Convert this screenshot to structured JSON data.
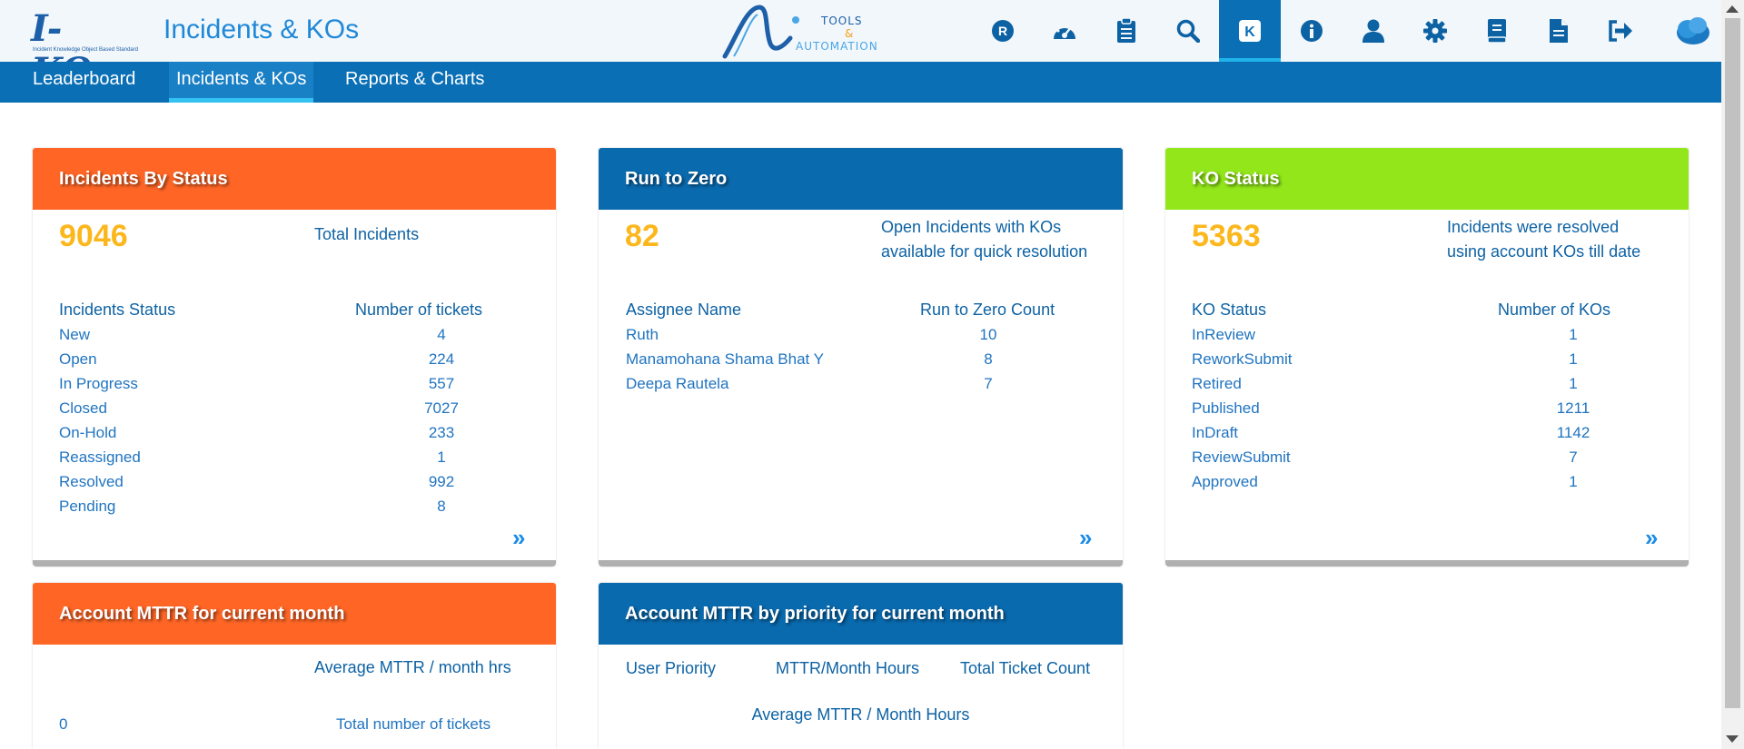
{
  "header": {
    "logo_text": "I-KO",
    "logo_eta": "η",
    "logo_subtitle": "Incident Knowledge Object Based Standard",
    "app_title": "Incidents & KOs",
    "partner_logo": {
      "line1": "TOOLS",
      "amp": "&",
      "line2": "AUTOMATION"
    },
    "icons": [
      "r-badge-icon",
      "dashboard-gauge-icon",
      "clipboard-icon",
      "search-icon",
      "ko-icon",
      "info-icon",
      "user-icon",
      "gear-icon",
      "book-icon",
      "document-icon",
      "logout-icon"
    ],
    "active_icon": "ko-icon"
  },
  "nav": {
    "items": [
      {
        "label": "Leaderboard"
      },
      {
        "label": "Incidents & KOs"
      },
      {
        "label": "Reports & Charts"
      }
    ],
    "active": "Incidents & KOs"
  },
  "cards": {
    "incidents_by_status": {
      "title": "Incidents By Status",
      "total": "9046",
      "total_label": "Total Incidents",
      "col1": "Incidents Status",
      "col2": "Number of tickets",
      "rows": [
        {
          "status": "New",
          "count": "4"
        },
        {
          "status": "Open",
          "count": "224"
        },
        {
          "status": "In Progress",
          "count": "557"
        },
        {
          "status": "Closed",
          "count": "7027"
        },
        {
          "status": "On-Hold",
          "count": "233"
        },
        {
          "status": "Reassigned",
          "count": "1"
        },
        {
          "status": "Resolved",
          "count": "992"
        },
        {
          "status": "Pending",
          "count": "8"
        }
      ],
      "more": "»"
    },
    "run_to_zero": {
      "title": "Run to Zero",
      "total": "82",
      "desc_line1": "Open Incidents with KOs",
      "desc_line2": "available for quick resolution",
      "col1": "Assignee Name",
      "col2": "Run to Zero Count",
      "rows": [
        {
          "name": "Ruth",
          "count": "10"
        },
        {
          "name": "Manamohana Shama Bhat Y",
          "count": "8"
        },
        {
          "name": "Deepa Rautela",
          "count": "7"
        }
      ],
      "more": "»"
    },
    "ko_status": {
      "title": "KO Status",
      "total": "5363",
      "desc_line1": "Incidents were resolved",
      "desc_line2": "using account KOs till date",
      "col1": "KO Status",
      "col2": "Number of KOs",
      "rows": [
        {
          "status": "InReview",
          "count": "1"
        },
        {
          "status": "ReworkSubmit",
          "count": "1"
        },
        {
          "status": "Retired",
          "count": "1"
        },
        {
          "status": "Published",
          "count": "1211"
        },
        {
          "status": "InDraft",
          "count": "1142"
        },
        {
          "status": "ReviewSubmit",
          "count": "7"
        },
        {
          "status": "Approved",
          "count": "1"
        }
      ],
      "more": "»"
    },
    "mttr_month": {
      "title": "Account MTTR for current month",
      "avg_label": "Average MTTR / month hrs",
      "tickets_value": "0",
      "tickets_label": "Total number of tickets"
    },
    "mttr_priority": {
      "title": "Account MTTR by priority for current month",
      "col1": "User Priority",
      "col2": "MTTR/Month Hours",
      "col3": "Total Ticket Count",
      "avg_label": "Average MTTR / Month Hours"
    }
  },
  "colors": {
    "header_bg": "#f2f7fb",
    "nav_bg": "#0a6fb5",
    "orange": "#ff6626",
    "blue": "#0a6aae",
    "green": "#92e61a",
    "highlight_number": "#fbb71c",
    "text_blue": "#0d62a4"
  }
}
